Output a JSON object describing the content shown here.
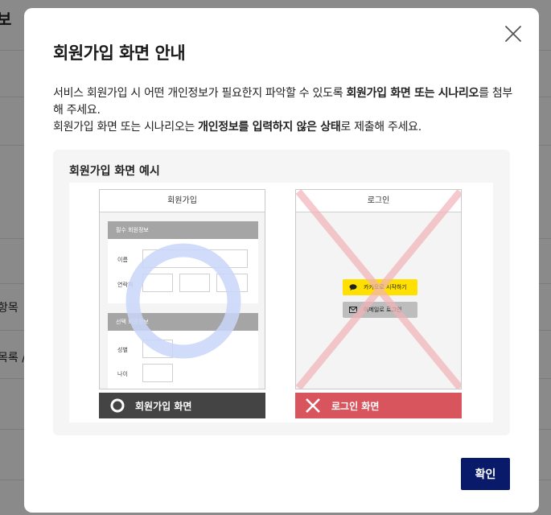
{
  "background": {
    "title_fragment": "보",
    "row1": "항목",
    "row2": "목록 /"
  },
  "modal": {
    "title": "회원가입 화면 안내",
    "desc": {
      "p1a": "서비스 회원가입 시 어떤 개인정보가 필요한지 파악할 수 있도록 ",
      "p1b": "회원가입 화면 또는 시나리오",
      "p1c": "를 첨부해 주세요.",
      "p2a": "회원가입 화면 또는 시나리오는 ",
      "p2b": "개인정보를 입력하지 않은 상태",
      "p2c": "로 제출해 주세요."
    },
    "example": {
      "title": "회원가입 화면 예시",
      "good": {
        "header": "회원가입",
        "required_section": "필수 회원정보",
        "name_label": "이름",
        "contact_label": "연락처",
        "optional_section": "선택 회원정보",
        "gender_label": "성별",
        "age_label": "나이",
        "caption": "회원가입 화면"
      },
      "bad": {
        "header": "로그인",
        "kakao_btn": "카카오로 시작하기",
        "email_btn": "이메일로 로그인",
        "caption": "로그인 화면"
      }
    },
    "confirm_label": "확인",
    "colors": {
      "confirm": "#0a1a6b",
      "good_caption": "#444444",
      "bad_caption": "#d9555d",
      "circle": "#c8d6f8",
      "cross": "#f2b3b8",
      "kakao": "#ffe000"
    }
  }
}
